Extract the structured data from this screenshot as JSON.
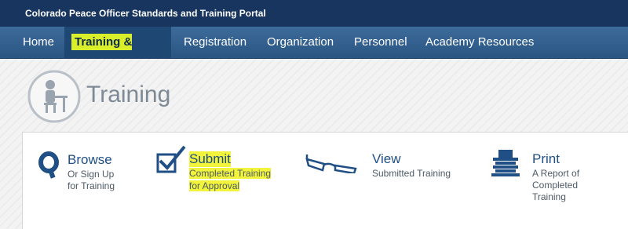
{
  "header": {
    "portal_title": "Colorado Peace Officer Standards and Training Portal"
  },
  "nav": {
    "items": [
      {
        "label": "Home"
      },
      {
        "label": "Training & Events"
      },
      {
        "label": "Registration"
      },
      {
        "label": "Organization"
      },
      {
        "label": "Personnel"
      },
      {
        "label": "Academy Resources"
      }
    ],
    "active_index": 1
  },
  "page": {
    "title": "Training"
  },
  "tiles": [
    {
      "icon": "q-browse-icon",
      "title": "Browse",
      "sub_lines": [
        "Or Sign Up",
        "for Training"
      ]
    },
    {
      "icon": "checkbox-icon",
      "title": "Submit",
      "sub_lines": [
        "Completed Training",
        "for Approval"
      ],
      "highlighted": true
    },
    {
      "icon": "glasses-icon",
      "title": "View",
      "sub_lines": [
        "Submitted Training"
      ]
    },
    {
      "icon": "printer-icon",
      "title": "Print",
      "sub_lines": [
        "A Report of",
        "Completed",
        "Training"
      ]
    }
  ],
  "colors": {
    "top_bar": "#17355e",
    "nav_bar": "#2a5583",
    "highlight": "#f1f43a",
    "link": "#1f4f85"
  }
}
